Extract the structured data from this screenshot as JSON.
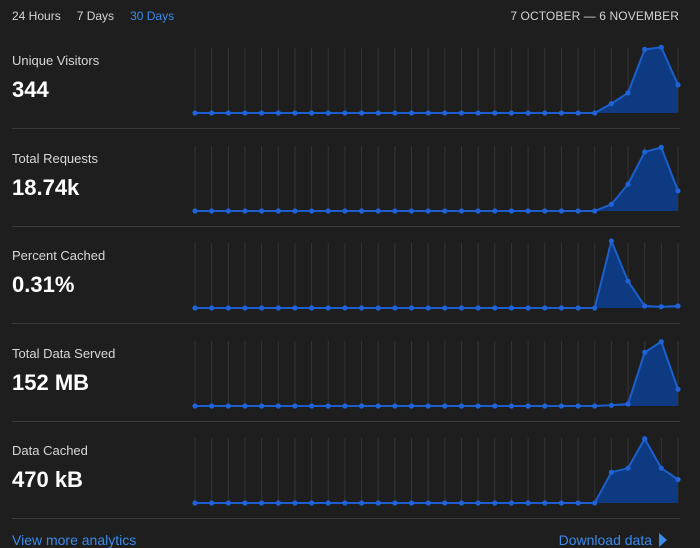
{
  "range_tabs": [
    {
      "label": "24 Hours",
      "active": false
    },
    {
      "label": "7 Days",
      "active": false
    },
    {
      "label": "30 Days",
      "active": true
    }
  ],
  "date_range": "7 OCTOBER — 6 NOVEMBER",
  "colors": {
    "accent": "#3b8beb",
    "area_fill": "#0d3a80",
    "line": "#1c5fcc",
    "dot": "#1f63d6",
    "grid": "#343434"
  },
  "metrics": [
    {
      "label": "Unique Visitors",
      "value": "344",
      "series": [
        0,
        0,
        0,
        0,
        0,
        0,
        0,
        0,
        0,
        0,
        0,
        0,
        0,
        0,
        0,
        0,
        0,
        0,
        0,
        0,
        0,
        0,
        0,
        0,
        0,
        0.14,
        0.3,
        0.95,
        0.98,
        0.42
      ]
    },
    {
      "label": "Total Requests",
      "value": "18.74k",
      "series": [
        0,
        0,
        0,
        0,
        0,
        0,
        0,
        0,
        0,
        0,
        0,
        0,
        0,
        0,
        0,
        0,
        0,
        0,
        0,
        0,
        0,
        0,
        0,
        0,
        0,
        0.1,
        0.4,
        0.88,
        0.95,
        0.3
      ]
    },
    {
      "label": "Percent Cached",
      "value": "0.31%",
      "series": [
        0,
        0,
        0,
        0,
        0,
        0,
        0,
        0,
        0,
        0,
        0,
        0,
        0,
        0,
        0,
        0,
        0,
        0,
        0,
        0,
        0,
        0,
        0,
        0,
        0,
        1.0,
        0.4,
        0.03,
        0.02,
        0.03
      ]
    },
    {
      "label": "Total Data Served",
      "value": "152 MB",
      "series": [
        0,
        0,
        0,
        0,
        0,
        0,
        0,
        0,
        0,
        0,
        0,
        0,
        0,
        0,
        0,
        0,
        0,
        0,
        0,
        0,
        0,
        0,
        0,
        0,
        0,
        0.01,
        0.03,
        0.8,
        0.96,
        0.25
      ]
    },
    {
      "label": "Data Cached",
      "value": "470 kB",
      "series": [
        0,
        0,
        0,
        0,
        0,
        0,
        0,
        0,
        0,
        0,
        0,
        0,
        0,
        0,
        0,
        0,
        0,
        0,
        0,
        0,
        0,
        0,
        0,
        0,
        0,
        0.46,
        0.52,
        0.96,
        0.52,
        0.35
      ]
    }
  ],
  "footer": {
    "left_link": "View more analytics",
    "right_link": "Download data",
    "right_icon": "play-icon"
  }
}
